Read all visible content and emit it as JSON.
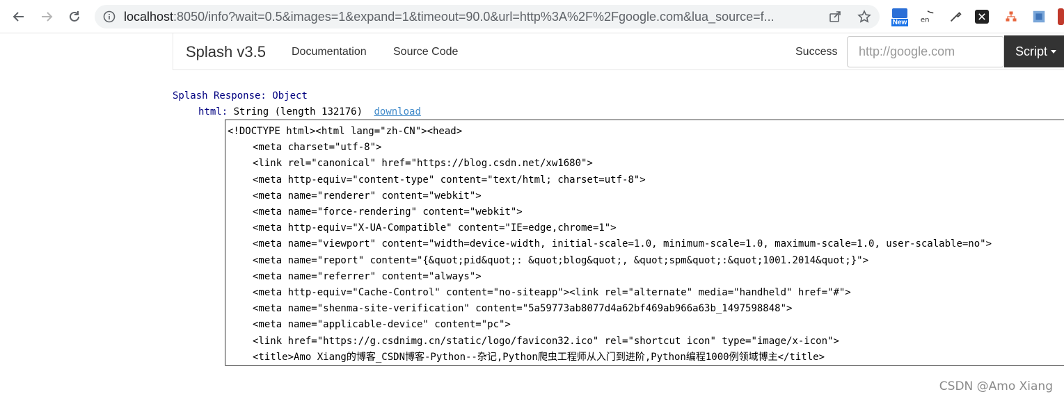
{
  "browser": {
    "url_host": "localhost",
    "url_rest": ":8050/info?wait=0.5&images=1&expand=1&timeout=90.0&url=http%3A%2F%2Fgoogle.com&lua_source=f...",
    "ext_new_label": "New"
  },
  "navbar": {
    "brand": "Splash v3.5",
    "links": [
      "Documentation",
      "Source Code"
    ],
    "status": "Success",
    "url_placeholder": "http://google.com",
    "script_label": "Script"
  },
  "response": {
    "label": "Splash Response:",
    "type": "Object",
    "html_key": "html:",
    "html_type": "String (length 132176)",
    "download_label": "download"
  },
  "code_lines": [
    "<!DOCTYPE html><html lang=\"zh-CN\"><head>",
    "<meta charset=\"utf-8\">",
    "<link rel=\"canonical\" href=\"https://blog.csdn.net/xw1680\">",
    "<meta http-equiv=\"content-type\" content=\"text/html; charset=utf-8\">",
    "<meta name=\"renderer\" content=\"webkit\">",
    "<meta name=\"force-rendering\" content=\"webkit\">",
    "<meta http-equiv=\"X-UA-Compatible\" content=\"IE=edge,chrome=1\">",
    "<meta name=\"viewport\" content=\"width=device-width, initial-scale=1.0, minimum-scale=1.0, maximum-scale=1.0, user-scalable=no\">",
    "<meta name=\"report\" content=\"{&quot;pid&quot;: &quot;blog&quot;, &quot;spm&quot;:&quot;1001.2014&quot;}\">",
    "<meta name=\"referrer\" content=\"always\">",
    "<meta http-equiv=\"Cache-Control\" content=\"no-siteapp\"><link rel=\"alternate\" media=\"handheld\" href=\"#\">",
    "<meta name=\"shenma-site-verification\" content=\"5a59773ab8077d4a62bf469ab966a63b_1497598848\">",
    "<meta name=\"applicable-device\" content=\"pc\">",
    "<link href=\"https://g.csdnimg.cn/static/logo/favicon32.ico\" rel=\"shortcut icon\" type=\"image/x-icon\">",
    "<title>Amo Xiang的博客_CSDN博客-Python--杂记,Python爬虫工程师从入门到进阶,Python编程1000例领域博主</title>"
  ],
  "watermark": "CSDN @Amo Xiang"
}
